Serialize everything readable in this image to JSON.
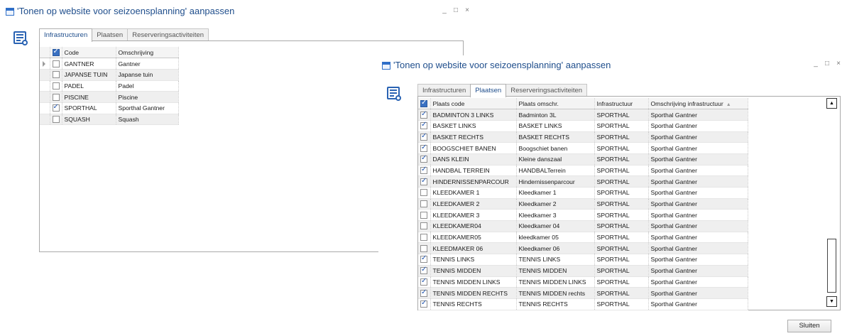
{
  "window_back": {
    "title": "'Tonen op website voor seizoensplanning' aanpassen",
    "controls": [
      "_",
      "□",
      "×"
    ],
    "tabs": [
      "Infrastructuren",
      "Plaatsen",
      "Reserveringsactiviteiten"
    ],
    "active_tab": "Infrastructuren",
    "grid": {
      "headers": [
        "Code",
        "Omschrijving"
      ],
      "header_checked": true,
      "rows": [
        {
          "checked": false,
          "current": true,
          "code": "GANTNER",
          "omschrijving": "Gantner"
        },
        {
          "checked": false,
          "current": false,
          "code": "JAPANSE TUIN",
          "omschrijving": "Japanse tuin"
        },
        {
          "checked": false,
          "current": false,
          "code": "PADEL",
          "omschrijving": "Padel"
        },
        {
          "checked": false,
          "current": false,
          "code": "PISCINE",
          "omschrijving": "Piscine"
        },
        {
          "checked": true,
          "current": false,
          "code": "SPORTHAL",
          "omschrijving": "Sporthal Gantner"
        },
        {
          "checked": false,
          "current": false,
          "code": "SQUASH",
          "omschrijving": "Squash"
        }
      ]
    }
  },
  "window_front": {
    "title": "'Tonen op website voor seizoensplanning' aanpassen",
    "controls": [
      "_",
      "□",
      "×"
    ],
    "tabs": [
      "Infrastructuren",
      "Plaatsen",
      "Reserveringsactiviteiten"
    ],
    "active_tab": "Plaatsen",
    "grid": {
      "headers": [
        "Plaats code",
        "Plaats omschr.",
        "Infrastructuur",
        "Omschrijving infrastructuur"
      ],
      "header_checked": true,
      "sorted_column": "Omschrijving infrastructuur",
      "rows": [
        {
          "checked": true,
          "code": "BADMINTON 3 LINKS",
          "omschr": "Badminton 3L",
          "infra": "SPORTHAL",
          "infra_omschr": "Sporthal Gantner"
        },
        {
          "checked": true,
          "code": "BASKET LINKS",
          "omschr": "BASKET LINKS",
          "infra": "SPORTHAL",
          "infra_omschr": "Sporthal Gantner"
        },
        {
          "checked": true,
          "code": "BASKET RECHTS",
          "omschr": "BASKET RECHTS",
          "infra": "SPORTHAL",
          "infra_omschr": "Sporthal Gantner"
        },
        {
          "checked": true,
          "code": "BOOGSCHIET BANEN",
          "omschr": "Boogschiet banen",
          "infra": "SPORTHAL",
          "infra_omschr": "Sporthal Gantner"
        },
        {
          "checked": true,
          "code": "DANS KLEIN",
          "omschr": "Kleine danszaal",
          "infra": "SPORTHAL",
          "infra_omschr": "Sporthal Gantner"
        },
        {
          "checked": true,
          "code": "HANDBAL TERREIN",
          "omschr": "HANDBALTerrein",
          "infra": "SPORTHAL",
          "infra_omschr": "Sporthal Gantner"
        },
        {
          "checked": true,
          "code": "HINDERNISSENPARCOUR",
          "omschr": "Hindernissenparcour",
          "infra": "SPORTHAL",
          "infra_omschr": "Sporthal Gantner"
        },
        {
          "checked": false,
          "code": "KLEEDKAMER 1",
          "omschr": "Kleedkamer 1",
          "infra": "SPORTHAL",
          "infra_omschr": "Sporthal Gantner"
        },
        {
          "checked": false,
          "code": "KLEEDKAMER 2",
          "omschr": "Kleedkamer 2",
          "infra": "SPORTHAL",
          "infra_omschr": "Sporthal Gantner"
        },
        {
          "checked": false,
          "code": "KLEEDKAMER 3",
          "omschr": "Kleedkamer 3",
          "infra": "SPORTHAL",
          "infra_omschr": "Sporthal Gantner"
        },
        {
          "checked": false,
          "code": "KLEEDKAMER04",
          "omschr": "Kleedkamer 04",
          "infra": "SPORTHAL",
          "infra_omschr": "Sporthal Gantner"
        },
        {
          "checked": false,
          "code": "KLEEDKAMER05",
          "omschr": "kleedkamer 05",
          "infra": "SPORTHAL",
          "infra_omschr": "Sporthal Gantner"
        },
        {
          "checked": false,
          "code": "KLEEDMAKER 06",
          "omschr": "Kleedkamer 06",
          "infra": "SPORTHAL",
          "infra_omschr": "Sporthal Gantner"
        },
        {
          "checked": true,
          "code": "TENNIS LINKS",
          "omschr": "TENNIS LINKS",
          "infra": "SPORTHAL",
          "infra_omschr": "Sporthal Gantner"
        },
        {
          "checked": true,
          "code": "TENNIS MIDDEN",
          "omschr": "TENNIS MIDDEN",
          "infra": "SPORTHAL",
          "infra_omschr": "Sporthal Gantner"
        },
        {
          "checked": true,
          "code": "TENNIS MIDDEN LINKS",
          "omschr": "TENNIS MIDDEN LINKS",
          "infra": "SPORTHAL",
          "infra_omschr": "Sporthal Gantner"
        },
        {
          "checked": true,
          "code": "TENNIS MIDDEN RECHTS",
          "omschr": "TENNIS MIDDEN rechts",
          "infra": "SPORTHAL",
          "infra_omschr": "Sporthal Gantner"
        },
        {
          "checked": true,
          "code": "TENNIS RECHTS",
          "omschr": "TENNIS RECHTS",
          "infra": "SPORTHAL",
          "infra_omschr": "Sporthal Gantner"
        }
      ]
    },
    "scrollbar": {
      "up": "▲",
      "down": "▼"
    },
    "close_button": "Sluiten"
  },
  "colors": {
    "accent": "#1f4e8c",
    "icon_blue": "#2a63b3",
    "check_blue": "#2055b0"
  }
}
